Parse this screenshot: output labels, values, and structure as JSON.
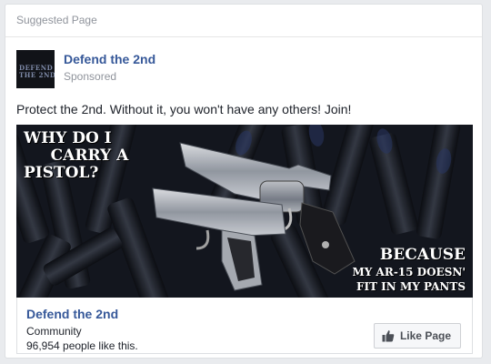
{
  "header": {
    "label": "Suggested Page"
  },
  "post": {
    "avatar_lines": [
      "DEFEND",
      "THE 2ND"
    ],
    "page_name": "Defend the 2nd",
    "sponsored_label": "Sponsored",
    "text": "Protect the 2nd. Without it, you won't have any others! Join!"
  },
  "ad_image": {
    "caption_top": "WHY DO I\n     CARRY A\nPISTOL?",
    "caption_bottom_line1": "BECAUSE",
    "caption_bottom_line2": "MY AR-15 DOESN'",
    "caption_bottom_line3": "FIT IN MY PANTS"
  },
  "footer": {
    "page_name": "Defend the 2nd",
    "category": "Community",
    "likes_text": "96,954 people like this.",
    "like_button_label": "Like Page",
    "like_button_icon": "thumbs-up-icon"
  },
  "colors": {
    "link_blue": "#365899",
    "muted_gray": "#90949c",
    "text_dark": "#1d2129",
    "card_border": "#dddfe2",
    "page_bg": "#e9ebee"
  }
}
